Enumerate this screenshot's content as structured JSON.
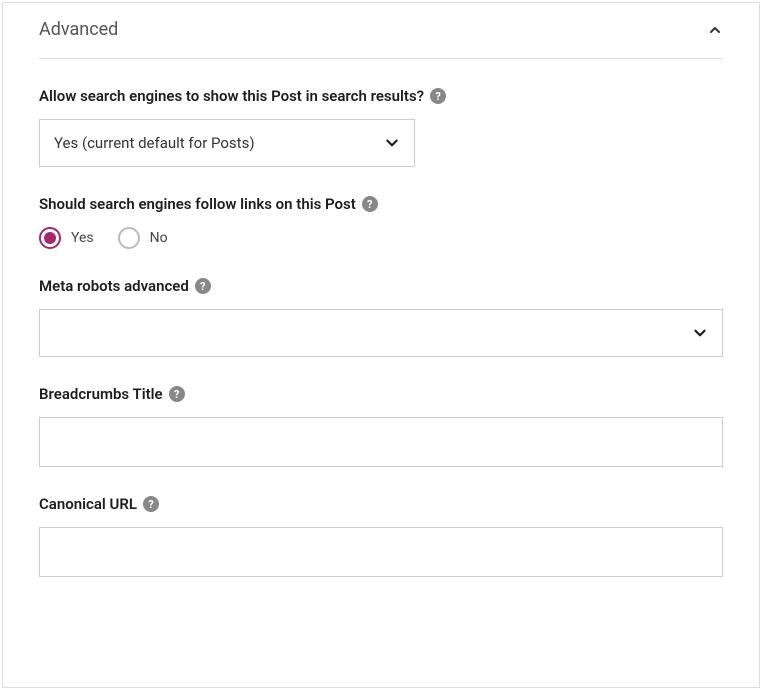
{
  "panel": {
    "title": "Advanced"
  },
  "fields": {
    "allow_search": {
      "label": "Allow search engines to show this Post in search results?",
      "value": "Yes (current default for Posts)"
    },
    "follow_links": {
      "label": "Should search engines follow links on this Post",
      "options": {
        "yes": "Yes",
        "no": "No"
      },
      "selected": "yes"
    },
    "meta_robots": {
      "label": "Meta robots advanced",
      "value": ""
    },
    "breadcrumbs": {
      "label": "Breadcrumbs Title",
      "value": ""
    },
    "canonical": {
      "label": "Canonical URL",
      "value": ""
    }
  }
}
